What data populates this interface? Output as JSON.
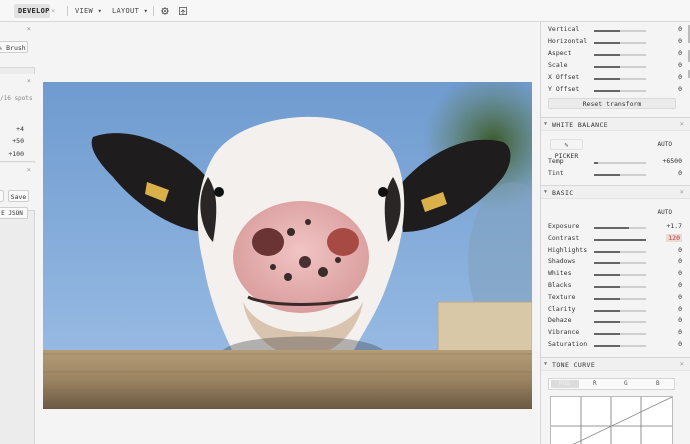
{
  "toolbar": {
    "develop": "DEVELOP",
    "develop_close": "×",
    "view": "VIEW ▾",
    "layout": "LAYOUT ▾",
    "icons": [
      "gear-icon",
      "export-icon"
    ]
  },
  "left": {
    "close1": "×",
    "brush": "Brush",
    "close2": "×",
    "spots": "/16 spots",
    "v1": "+4",
    "v2": "+50",
    "v3": "+100",
    "close3": "×",
    "save": "Save",
    "json": "E JSON"
  },
  "right": {
    "geometry": [
      {
        "label": "Vertical",
        "value": "0",
        "fill": 0.5
      },
      {
        "label": "Horizontal",
        "value": "0",
        "fill": 0.5
      },
      {
        "label": "Aspect",
        "value": "0",
        "fill": 0.5
      },
      {
        "label": "Scale",
        "value": "0",
        "fill": 0.5
      },
      {
        "label": "X Offset",
        "value": "0",
        "fill": 0.5
      },
      {
        "label": "Y Offset",
        "value": "0",
        "fill": 0.5
      }
    ],
    "reset": "Reset transform",
    "wb": {
      "title": "WHITE BALANCE",
      "picker": "PICKER",
      "auto": "AUTO",
      "rows": [
        {
          "label": "Temp",
          "value": "+6500",
          "fill": 0.08
        },
        {
          "label": "Tint",
          "value": "0",
          "fill": 0.5
        }
      ]
    },
    "basic": {
      "title": "BASIC",
      "auto": "AUTO",
      "rows": [
        {
          "label": "Exposure",
          "value": "+1.7",
          "fill": 0.68
        },
        {
          "label": "Contrast",
          "value": "120",
          "fill": 1.0,
          "highlight": true
        },
        {
          "label": "Highlights",
          "value": "0",
          "fill": 0.5
        },
        {
          "label": "Shadows",
          "value": "0",
          "fill": 0.5
        },
        {
          "label": "Whites",
          "value": "0",
          "fill": 0.5
        },
        {
          "label": "Blacks",
          "value": "0",
          "fill": 0.5
        },
        {
          "label": "Texture",
          "value": "0",
          "fill": 0.5
        },
        {
          "label": "Clarity",
          "value": "0",
          "fill": 0.5
        },
        {
          "label": "Dehaze",
          "value": "0",
          "fill": 0.5
        },
        {
          "label": "Vibrance",
          "value": "0",
          "fill": 0.5
        },
        {
          "label": "Saturation",
          "value": "0",
          "fill": 0.5
        }
      ]
    },
    "tone": {
      "title": "TONE CURVE",
      "tabs": [
        "RGB",
        "R",
        "G",
        "B"
      ]
    },
    "close": "×"
  }
}
